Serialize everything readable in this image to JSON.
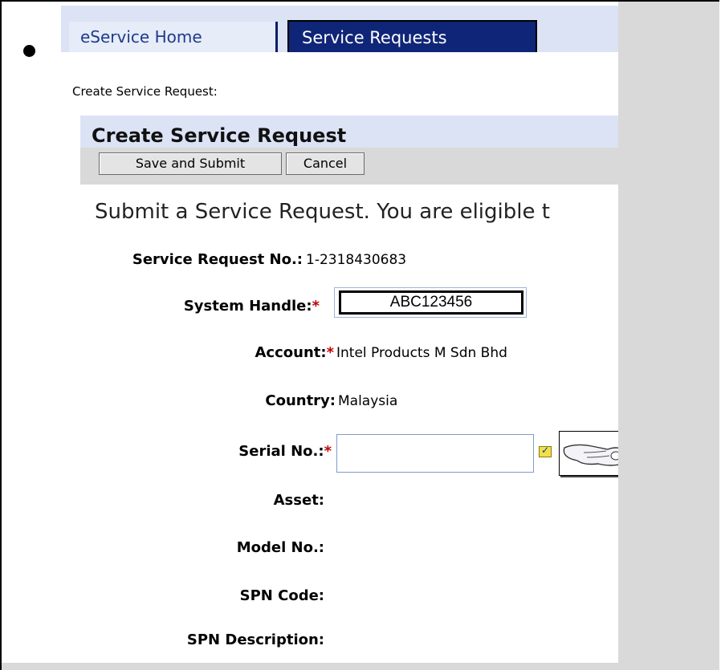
{
  "tabs": {
    "home": "eService Home",
    "requests": "Service Requests"
  },
  "breadcrumb": "Create Service Request:",
  "section_title": "Create Service Request",
  "toolbar": {
    "save_label": "Save and Submit",
    "cancel_label": "Cancel"
  },
  "intro_text": "Submit a Service Request. You are eligible t",
  "form": {
    "sr_no_label": "Service Request No.:",
    "sr_no_value": "1-2318430683",
    "system_handle_label": "System Handle:",
    "system_handle_value": "ABC123456",
    "account_label": "Account:",
    "account_value": "Intel Products M Sdn Bhd",
    "country_label": "Country:",
    "country_value": "Malaysia",
    "serial_label": "Serial No.:",
    "serial_value": "",
    "asset_label": "Asset:",
    "model_label": "Model No.:",
    "spn_code_label": "SPN Code:",
    "spn_desc_label": "SPN Description:"
  },
  "required_marker": "*",
  "icons": {
    "picker": "pick-list-icon",
    "pointer": "pointing-hand-icon"
  },
  "colors": {
    "tab_active_bg": "#0f2577",
    "header_band": "#dbe3f5",
    "required": "#c00000",
    "slide_bg": "#d9d9d9"
  }
}
